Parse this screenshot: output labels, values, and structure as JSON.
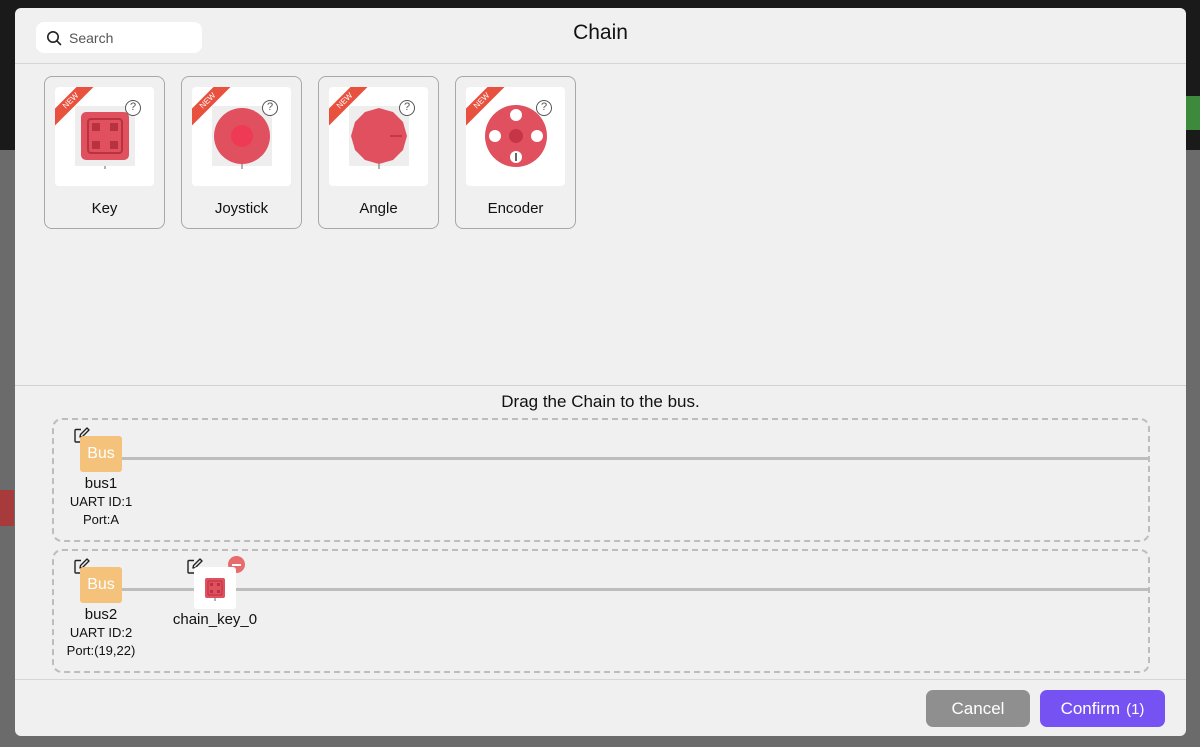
{
  "dialog": {
    "title": "Chain",
    "search": {
      "placeholder": "Search",
      "value": ""
    }
  },
  "palette": {
    "badge": "NEW",
    "help_glyph": "?",
    "items": [
      {
        "label": "Key",
        "icon": "key-unit-icon",
        "color": "#e0505f"
      },
      {
        "label": "Joystick",
        "icon": "joystick-unit-icon",
        "color": "#e0505f"
      },
      {
        "label": "Angle",
        "icon": "angle-unit-icon",
        "color": "#e0505f"
      },
      {
        "label": "Encoder",
        "icon": "encoder-unit-icon",
        "color": "#e0505f"
      }
    ]
  },
  "bus_area": {
    "hint": "Drag the Chain to the bus.",
    "buses": [
      {
        "chip_label": "Bus",
        "name": "bus1",
        "uart": "UART ID:1",
        "port": "Port:A",
        "nodes": []
      },
      {
        "chip_label": "Bus",
        "name": "bus2",
        "uart": "UART ID:2",
        "port": "Port:(19,22)",
        "nodes": [
          {
            "name": "chain_key_0",
            "icon": "key-unit-icon"
          }
        ]
      }
    ]
  },
  "footer": {
    "cancel_label": "Cancel",
    "confirm_label": "Confirm",
    "confirm_count": "(1)"
  },
  "colors": {
    "accent": "#7652f2",
    "bus_chip": "#f4c27b",
    "new_badge": "#e8513e",
    "remove": "#e86c6c",
    "unit_red": "#e0505f"
  }
}
